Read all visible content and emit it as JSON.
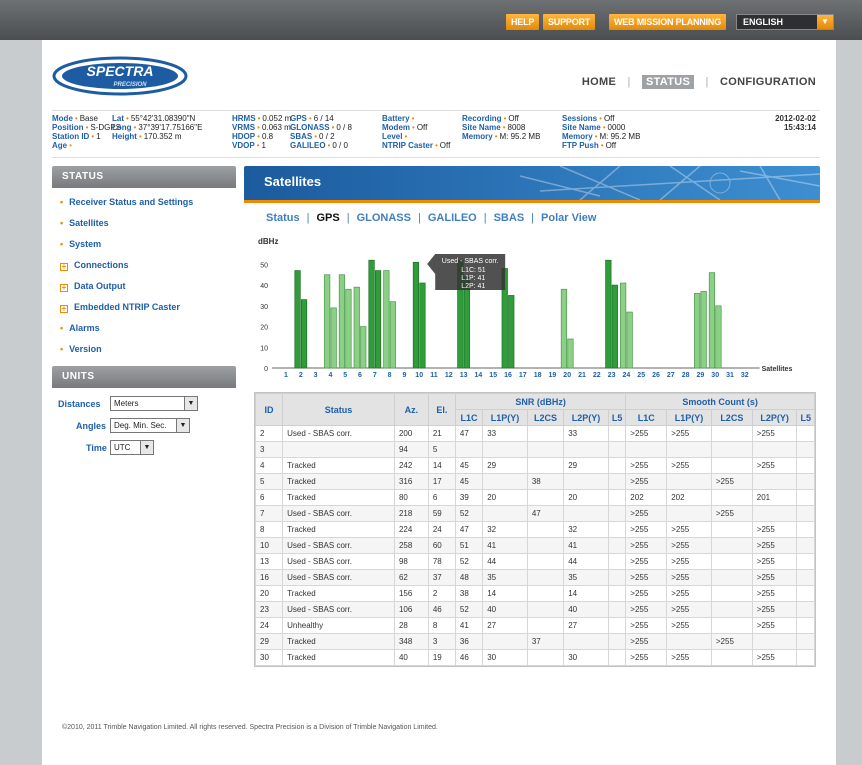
{
  "topbar": {
    "help": "HELP",
    "support": "SUPPORT",
    "web_mission": "WEB MISSION PLANNING",
    "language": "ENGLISH"
  },
  "logo": {
    "brand": "SPECTRA",
    "sub": "PRECISION"
  },
  "nav": {
    "home": "HOME",
    "status": "STATUS",
    "configuration": "CONFIGURATION"
  },
  "statusbar": {
    "col1": [
      {
        "label": "Mode",
        "value": "Base"
      },
      {
        "label": "Position",
        "value": "S-DGPS"
      },
      {
        "label": "Station ID",
        "value": "1"
      },
      {
        "label": "Age",
        "value": ""
      }
    ],
    "col2": [
      {
        "label": "Lat",
        "value": "55°42'31.08390\"N"
      },
      {
        "label": "Long",
        "value": "37°39'17.75166\"E"
      },
      {
        "label": "Height",
        "value": "170.352 m"
      },
      {
        "label": "",
        "value": ""
      }
    ],
    "col3": [
      {
        "label": "HRMS",
        "value": "0.052 m"
      },
      {
        "label": "VRMS",
        "value": "0.063 m"
      },
      {
        "label": "HDOP",
        "value": "0.8"
      },
      {
        "label": "VDOP",
        "value": "1"
      }
    ],
    "col4": [
      {
        "label": "GPS",
        "value": "6 / 14"
      },
      {
        "label": "GLONASS",
        "value": "0 / 8"
      },
      {
        "label": "SBAS",
        "value": "0 / 2"
      },
      {
        "label": "GALILEO",
        "value": "0 / 0"
      }
    ],
    "col5": [
      {
        "label": "Battery",
        "value": ""
      },
      {
        "label": "Modem",
        "value": "Off"
      },
      {
        "label": "Level",
        "value": ""
      },
      {
        "label": "NTRIP Caster",
        "value": "Off"
      }
    ],
    "col6": [
      {
        "label": "Recording",
        "value": "Off"
      },
      {
        "label": "Site Name",
        "value": "8008"
      },
      {
        "label": "Memory",
        "value": "M: 95.2 MB"
      },
      {
        "label": "",
        "value": ""
      }
    ],
    "col7": [
      {
        "label": "Sessions",
        "value": "Off"
      },
      {
        "label": "Site Name",
        "value": "0000"
      },
      {
        "label": "Memory",
        "value": "M: 95.2 MB"
      },
      {
        "label": "FTP Push",
        "value": "Off"
      }
    ],
    "date": "2012-02-02",
    "time": "15:43:14"
  },
  "sidebar": {
    "status_title": "STATUS",
    "items": [
      {
        "label": "Receiver Status and Settings",
        "mark": "+"
      },
      {
        "label": "Satellites",
        "mark": "+"
      },
      {
        "label": "System",
        "mark": "+"
      },
      {
        "label": "Connections",
        "mark": "box"
      },
      {
        "label": "Data Output",
        "mark": "box"
      },
      {
        "label": "Embedded NTRIP Caster",
        "mark": "box"
      },
      {
        "label": "Alarms",
        "mark": "+"
      },
      {
        "label": "Version",
        "mark": "+"
      }
    ],
    "units_title": "UNITS",
    "units": {
      "distances_label": "Distances",
      "distances_value": "Meters",
      "angles_label": "Angles",
      "angles_value": "Deg. Min. Sec.",
      "time_label": "Time",
      "time_value": "UTC"
    }
  },
  "main": {
    "title": "Satellites",
    "tabs": [
      "Status",
      "GPS",
      "GLONASS",
      "GALILEO",
      "SBAS",
      "Polar View"
    ],
    "active_tab": "GPS"
  },
  "chart_data": {
    "type": "bar",
    "ylabel": "dBHz",
    "xlabel": "Satellites",
    "ylim": [
      0,
      55
    ],
    "yticks": [
      0,
      10,
      20,
      30,
      40,
      50
    ],
    "categories": [
      1,
      2,
      3,
      4,
      5,
      6,
      7,
      8,
      9,
      10,
      11,
      12,
      13,
      14,
      15,
      16,
      17,
      18,
      19,
      20,
      21,
      22,
      23,
      24,
      25,
      26,
      27,
      28,
      29,
      30,
      31,
      32
    ],
    "series": [
      {
        "name": "L1C",
        "values": [
          null,
          47,
          null,
          45,
          45,
          39,
          52,
          47,
          null,
          51,
          null,
          null,
          52,
          null,
          null,
          48,
          null,
          null,
          null,
          38,
          null,
          null,
          52,
          41,
          null,
          null,
          null,
          null,
          36,
          46,
          null,
          null
        ]
      },
      {
        "name": "L1P(Y)",
        "values": [
          null,
          33,
          null,
          29,
          null,
          20,
          null,
          32,
          null,
          41,
          null,
          null,
          44,
          null,
          null,
          35,
          null,
          null,
          null,
          14,
          null,
          null,
          40,
          27,
          null,
          null,
          null,
          null,
          null,
          30,
          null,
          null
        ]
      },
      {
        "name": "L2CS",
        "values": [
          null,
          null,
          null,
          null,
          38,
          null,
          47,
          null,
          null,
          null,
          null,
          null,
          null,
          null,
          null,
          null,
          null,
          null,
          null,
          null,
          null,
          null,
          null,
          null,
          null,
          null,
          null,
          null,
          37,
          null,
          null,
          null
        ]
      }
    ],
    "used": [
      2,
      7,
      10,
      13,
      16,
      23
    ],
    "tooltip": {
      "title": "Used - SBAS corr.",
      "lines": [
        "L1C: 51",
        "L1P: 41",
        "L2P: 41"
      ],
      "sat": 10
    },
    "colors": {
      "used": "#2f9e3a",
      "tracked": "#8ccf86",
      "used_edge": "#1f6e27",
      "tracked_edge": "#4a9a4c"
    }
  },
  "table": {
    "headers_top": [
      "ID",
      "Status",
      "Az.",
      "El.",
      "SNR (dBHz)",
      "Smooth Count (s)"
    ],
    "headers_sub": [
      "L1C",
      "L1P(Y)",
      "L2CS",
      "L2P(Y)",
      "L5",
      "L1C",
      "L1P(Y)",
      "L2CS",
      "L2P(Y)",
      "L5"
    ],
    "rows": [
      [
        "2",
        "Used - SBAS corr.",
        "200",
        "21",
        "47",
        "33",
        "",
        "33",
        "",
        ">255",
        ">255",
        "",
        ">255",
        ""
      ],
      [
        "3",
        "",
        "94",
        "5",
        "",
        "",
        "",
        "",
        "",
        "",
        "",
        "",
        "",
        ""
      ],
      [
        "4",
        "Tracked",
        "242",
        "14",
        "45",
        "29",
        "",
        "29",
        "",
        ">255",
        ">255",
        "",
        ">255",
        ""
      ],
      [
        "5",
        "Tracked",
        "316",
        "17",
        "45",
        "",
        "38",
        "",
        "",
        ">255",
        "",
        ">255",
        "",
        ""
      ],
      [
        "6",
        "Tracked",
        "80",
        "6",
        "39",
        "20",
        "",
        "20",
        "",
        "202",
        "202",
        "",
        "201",
        ""
      ],
      [
        "7",
        "Used - SBAS corr.",
        "218",
        "59",
        "52",
        "",
        "47",
        "",
        "",
        ">255",
        "",
        ">255",
        "",
        ""
      ],
      [
        "8",
        "Tracked",
        "224",
        "24",
        "47",
        "32",
        "",
        "32",
        "",
        ">255",
        ">255",
        "",
        ">255",
        ""
      ],
      [
        "10",
        "Used - SBAS corr.",
        "258",
        "60",
        "51",
        "41",
        "",
        "41",
        "",
        ">255",
        ">255",
        "",
        ">255",
        ""
      ],
      [
        "13",
        "Used - SBAS corr.",
        "98",
        "78",
        "52",
        "44",
        "",
        "44",
        "",
        ">255",
        ">255",
        "",
        ">255",
        ""
      ],
      [
        "16",
        "Used - SBAS corr.",
        "62",
        "37",
        "48",
        "35",
        "",
        "35",
        "",
        ">255",
        ">255",
        "",
        ">255",
        ""
      ],
      [
        "20",
        "Tracked",
        "156",
        "2",
        "38",
        "14",
        "",
        "14",
        "",
        ">255",
        ">255",
        "",
        ">255",
        ""
      ],
      [
        "23",
        "Used - SBAS corr.",
        "106",
        "46",
        "52",
        "40",
        "",
        "40",
        "",
        ">255",
        ">255",
        "",
        ">255",
        ""
      ],
      [
        "24",
        "Unhealthy",
        "28",
        "8",
        "41",
        "27",
        "",
        "27",
        "",
        ">255",
        ">255",
        "",
        ">255",
        ""
      ],
      [
        "29",
        "Tracked",
        "348",
        "3",
        "36",
        "",
        "37",
        "",
        "",
        ">255",
        "",
        ">255",
        "",
        ""
      ],
      [
        "30",
        "Tracked",
        "40",
        "19",
        "46",
        "30",
        "",
        "30",
        "",
        ">255",
        ">255",
        "",
        ">255",
        ""
      ]
    ]
  },
  "footer": "©2010, 2011 Trimble Navigation Limited. All rights reserved. Spectra Precision is a Division of Trimble Navigation Limited."
}
